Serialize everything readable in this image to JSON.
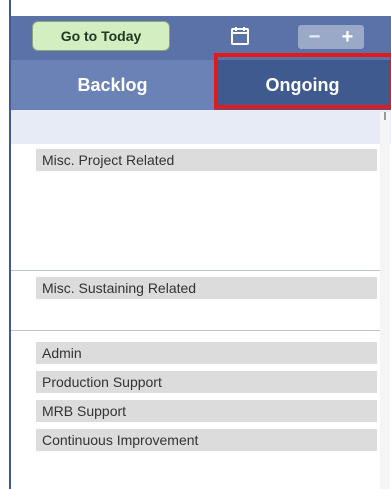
{
  "toolbar": {
    "goto_today_label": "Go to Today",
    "zoom_out_label": "−",
    "zoom_in_label": "+"
  },
  "tabs": [
    {
      "label": "Backlog"
    },
    {
      "label": "Ongoing"
    }
  ],
  "sections": [
    {
      "items": [
        "Misc. Project Related"
      ]
    },
    {
      "items": [
        "Misc. Sustaining Related"
      ]
    },
    {
      "items": [
        "Admin",
        "Production Support",
        "MRB Support",
        "Continuous Improvement"
      ]
    }
  ],
  "colors": {
    "toolbar_bg": "#5a72a8",
    "tab_selected_bg": "#3f5a8e",
    "highlight": "#e11b1b",
    "goto_button_bg": "#d3efc1"
  },
  "icons": {
    "calendar": "calendar-icon"
  }
}
